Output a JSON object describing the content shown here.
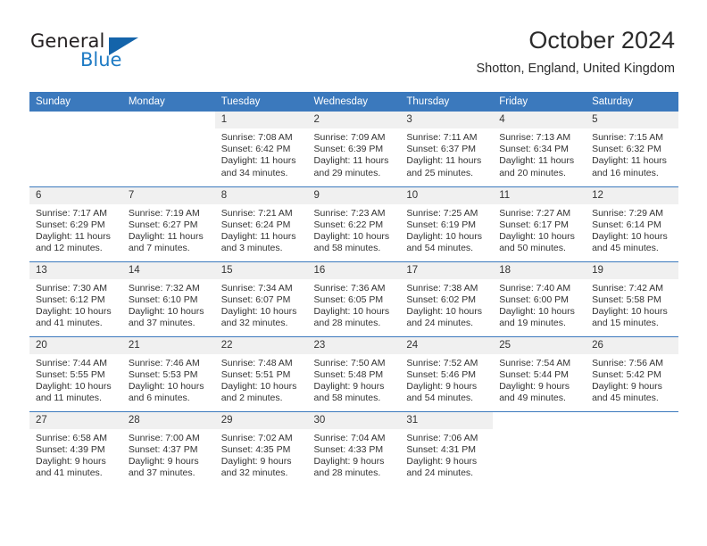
{
  "brand": {
    "name_top": "General",
    "name_bottom": "Blue",
    "triangle_color": "#1464aa",
    "blue_color": "#1e7bc4"
  },
  "header": {
    "title": "October 2024",
    "subtitle": "Shotton, England, United Kingdom"
  },
  "theme": {
    "header_blue": "#3b79bd",
    "daynum_gray": "#f0f0f0",
    "text": "#333333"
  },
  "weekdays": [
    "Sunday",
    "Monday",
    "Tuesday",
    "Wednesday",
    "Thursday",
    "Friday",
    "Saturday"
  ],
  "labels": {
    "sunrise": "Sunrise:",
    "sunset": "Sunset:",
    "daylight": "Daylight:"
  },
  "weeks": [
    [
      {
        "day": "",
        "sunrise": "",
        "sunset": "",
        "daylight": "",
        "blank": true
      },
      {
        "day": "",
        "sunrise": "",
        "sunset": "",
        "daylight": "",
        "blank": true
      },
      {
        "day": "1",
        "sunrise": "Sunrise: 7:08 AM",
        "sunset": "Sunset: 6:42 PM",
        "daylight": "Daylight: 11 hours and 34 minutes."
      },
      {
        "day": "2",
        "sunrise": "Sunrise: 7:09 AM",
        "sunset": "Sunset: 6:39 PM",
        "daylight": "Daylight: 11 hours and 29 minutes."
      },
      {
        "day": "3",
        "sunrise": "Sunrise: 7:11 AM",
        "sunset": "Sunset: 6:37 PM",
        "daylight": "Daylight: 11 hours and 25 minutes."
      },
      {
        "day": "4",
        "sunrise": "Sunrise: 7:13 AM",
        "sunset": "Sunset: 6:34 PM",
        "daylight": "Daylight: 11 hours and 20 minutes."
      },
      {
        "day": "5",
        "sunrise": "Sunrise: 7:15 AM",
        "sunset": "Sunset: 6:32 PM",
        "daylight": "Daylight: 11 hours and 16 minutes."
      }
    ],
    [
      {
        "day": "6",
        "sunrise": "Sunrise: 7:17 AM",
        "sunset": "Sunset: 6:29 PM",
        "daylight": "Daylight: 11 hours and 12 minutes."
      },
      {
        "day": "7",
        "sunrise": "Sunrise: 7:19 AM",
        "sunset": "Sunset: 6:27 PM",
        "daylight": "Daylight: 11 hours and 7 minutes."
      },
      {
        "day": "8",
        "sunrise": "Sunrise: 7:21 AM",
        "sunset": "Sunset: 6:24 PM",
        "daylight": "Daylight: 11 hours and 3 minutes."
      },
      {
        "day": "9",
        "sunrise": "Sunrise: 7:23 AM",
        "sunset": "Sunset: 6:22 PM",
        "daylight": "Daylight: 10 hours and 58 minutes."
      },
      {
        "day": "10",
        "sunrise": "Sunrise: 7:25 AM",
        "sunset": "Sunset: 6:19 PM",
        "daylight": "Daylight: 10 hours and 54 minutes."
      },
      {
        "day": "11",
        "sunrise": "Sunrise: 7:27 AM",
        "sunset": "Sunset: 6:17 PM",
        "daylight": "Daylight: 10 hours and 50 minutes."
      },
      {
        "day": "12",
        "sunrise": "Sunrise: 7:29 AM",
        "sunset": "Sunset: 6:14 PM",
        "daylight": "Daylight: 10 hours and 45 minutes."
      }
    ],
    [
      {
        "day": "13",
        "sunrise": "Sunrise: 7:30 AM",
        "sunset": "Sunset: 6:12 PM",
        "daylight": "Daylight: 10 hours and 41 minutes."
      },
      {
        "day": "14",
        "sunrise": "Sunrise: 7:32 AM",
        "sunset": "Sunset: 6:10 PM",
        "daylight": "Daylight: 10 hours and 37 minutes."
      },
      {
        "day": "15",
        "sunrise": "Sunrise: 7:34 AM",
        "sunset": "Sunset: 6:07 PM",
        "daylight": "Daylight: 10 hours and 32 minutes."
      },
      {
        "day": "16",
        "sunrise": "Sunrise: 7:36 AM",
        "sunset": "Sunset: 6:05 PM",
        "daylight": "Daylight: 10 hours and 28 minutes."
      },
      {
        "day": "17",
        "sunrise": "Sunrise: 7:38 AM",
        "sunset": "Sunset: 6:02 PM",
        "daylight": "Daylight: 10 hours and 24 minutes."
      },
      {
        "day": "18",
        "sunrise": "Sunrise: 7:40 AM",
        "sunset": "Sunset: 6:00 PM",
        "daylight": "Daylight: 10 hours and 19 minutes."
      },
      {
        "day": "19",
        "sunrise": "Sunrise: 7:42 AM",
        "sunset": "Sunset: 5:58 PM",
        "daylight": "Daylight: 10 hours and 15 minutes."
      }
    ],
    [
      {
        "day": "20",
        "sunrise": "Sunrise: 7:44 AM",
        "sunset": "Sunset: 5:55 PM",
        "daylight": "Daylight: 10 hours and 11 minutes."
      },
      {
        "day": "21",
        "sunrise": "Sunrise: 7:46 AM",
        "sunset": "Sunset: 5:53 PM",
        "daylight": "Daylight: 10 hours and 6 minutes."
      },
      {
        "day": "22",
        "sunrise": "Sunrise: 7:48 AM",
        "sunset": "Sunset: 5:51 PM",
        "daylight": "Daylight: 10 hours and 2 minutes."
      },
      {
        "day": "23",
        "sunrise": "Sunrise: 7:50 AM",
        "sunset": "Sunset: 5:48 PM",
        "daylight": "Daylight: 9 hours and 58 minutes."
      },
      {
        "day": "24",
        "sunrise": "Sunrise: 7:52 AM",
        "sunset": "Sunset: 5:46 PM",
        "daylight": "Daylight: 9 hours and 54 minutes."
      },
      {
        "day": "25",
        "sunrise": "Sunrise: 7:54 AM",
        "sunset": "Sunset: 5:44 PM",
        "daylight": "Daylight: 9 hours and 49 minutes."
      },
      {
        "day": "26",
        "sunrise": "Sunrise: 7:56 AM",
        "sunset": "Sunset: 5:42 PM",
        "daylight": "Daylight: 9 hours and 45 minutes."
      }
    ],
    [
      {
        "day": "27",
        "sunrise": "Sunrise: 6:58 AM",
        "sunset": "Sunset: 4:39 PM",
        "daylight": "Daylight: 9 hours and 41 minutes."
      },
      {
        "day": "28",
        "sunrise": "Sunrise: 7:00 AM",
        "sunset": "Sunset: 4:37 PM",
        "daylight": "Daylight: 9 hours and 37 minutes."
      },
      {
        "day": "29",
        "sunrise": "Sunrise: 7:02 AM",
        "sunset": "Sunset: 4:35 PM",
        "daylight": "Daylight: 9 hours and 32 minutes."
      },
      {
        "day": "30",
        "sunrise": "Sunrise: 7:04 AM",
        "sunset": "Sunset: 4:33 PM",
        "daylight": "Daylight: 9 hours and 28 minutes."
      },
      {
        "day": "31",
        "sunrise": "Sunrise: 7:06 AM",
        "sunset": "Sunset: 4:31 PM",
        "daylight": "Daylight: 9 hours and 24 minutes."
      },
      {
        "day": "",
        "sunrise": "",
        "sunset": "",
        "daylight": "",
        "blank": true
      },
      {
        "day": "",
        "sunrise": "",
        "sunset": "",
        "daylight": "",
        "blank": true
      }
    ]
  ]
}
